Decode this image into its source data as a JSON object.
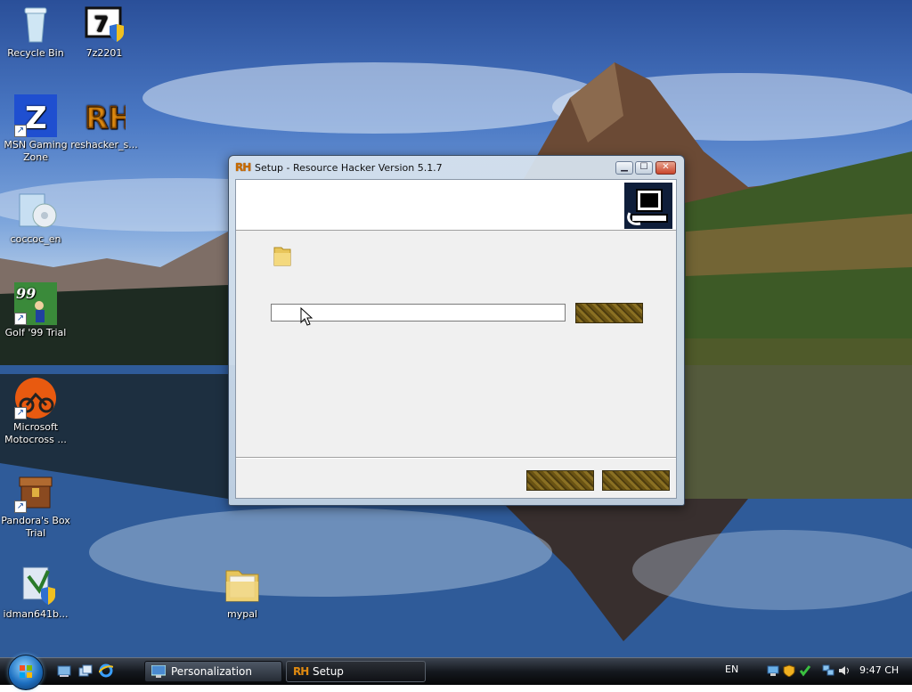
{
  "desktop": {
    "icons": [
      {
        "label": "Recycle Bin",
        "icon": "recycle-bin-icon"
      },
      {
        "label": "7z2201",
        "icon": "7zip-installer-icon"
      },
      {
        "label": "MSN Gaming Zone",
        "icon": "msn-gaming-zone-icon"
      },
      {
        "label": "reshacker_s...",
        "icon": "resource-hacker-icon"
      },
      {
        "label": "coccoc_en",
        "icon": "coccoc-installer-icon"
      },
      {
        "label": "Golf '99 Trial",
        "icon": "golf-icon"
      },
      {
        "label": "Microsoft Motocross ...",
        "icon": "motocross-icon"
      },
      {
        "label": "Pandora's Box Trial",
        "icon": "pandoras-box-icon"
      },
      {
        "label": "idman641b...",
        "icon": "idm-installer-icon"
      },
      {
        "label": "mypal",
        "icon": "folder-icon"
      }
    ]
  },
  "setup_window": {
    "title_icon": "RH",
    "title": "Setup - Resource Hacker Version 5.1.7",
    "caption_buttons": {
      "minimize": "minimize-icon",
      "maximize": "maximize-icon",
      "close": "close-icon"
    },
    "install_path_value": "",
    "browse_label": "",
    "back_label": "",
    "next_label": ""
  },
  "taskbar": {
    "tasks": [
      {
        "label": "Personalization",
        "icon": "personalization-icon"
      },
      {
        "label": "Setup",
        "icon": "RH"
      }
    ],
    "language": "EN",
    "clock": "9:47 CH"
  }
}
